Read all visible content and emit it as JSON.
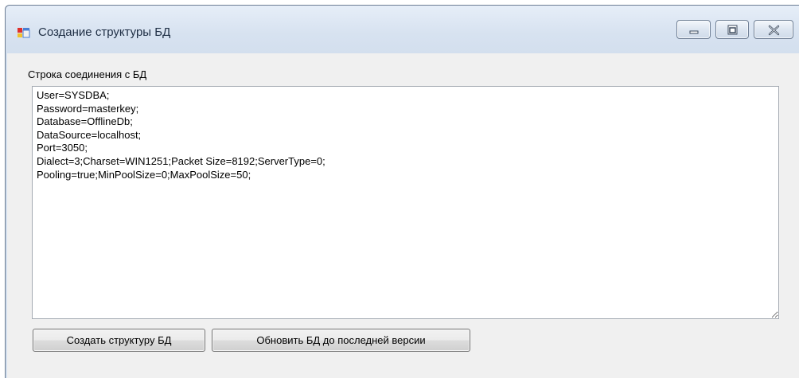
{
  "window": {
    "title": "Создание структуры БД",
    "icon": "app-window-icon"
  },
  "form": {
    "connection_label": "Строка соединения с БД",
    "connection_string": "User=SYSDBA;\nPassword=masterkey;\nDatabase=OfflineDb;\nDataSource=localhost;\nPort=3050;\nDialect=3;Charset=WIN1251;Packet Size=8192;ServerType=0;\nPooling=true;MinPoolSize=0;MaxPoolSize=50;"
  },
  "buttons": {
    "create_label": "Создать структуру БД",
    "update_label": "Обновить БД до последней версии"
  },
  "colors": {
    "titlebar": "#dbe5f1",
    "client": "#f0f0f0"
  }
}
